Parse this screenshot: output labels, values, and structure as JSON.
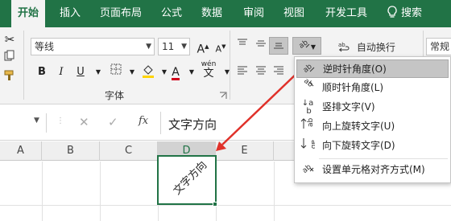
{
  "tabs": [
    "开始",
    "插入",
    "页面布局",
    "公式",
    "数据",
    "审阅",
    "视图",
    "开发工具"
  ],
  "tab_active_index": 0,
  "search_label": "搜索",
  "ribbon": {
    "font_name": "等线",
    "font_size": "11",
    "font_group_label": "字体",
    "wrap_text_label": "自动换行",
    "number_format": "常规",
    "bold": "B",
    "italic": "I",
    "underline": "U",
    "increase_font": "A",
    "decrease_font": "A",
    "font_color_letter": "A",
    "wen_label": "wén",
    "wen_char": "文"
  },
  "formula_bar": {
    "fx": "fx",
    "content": "文字方向"
  },
  "columns": [
    "A",
    "B",
    "C",
    "D",
    "E"
  ],
  "selected_column": "D",
  "cell_text": "文字方向",
  "menu_items": [
    {
      "label": "逆时针角度(O)",
      "icon": "angle-ccw-icon",
      "highlighted": true
    },
    {
      "label": "顺时针角度(L)",
      "icon": "angle-cw-icon",
      "highlighted": false
    },
    {
      "label": "竖排文字(V)",
      "icon": "vertical-text-icon",
      "highlighted": false
    },
    {
      "label": "向上旋转文字(U)",
      "icon": "rotate-up-icon",
      "highlighted": false
    },
    {
      "label": "向下旋转文字(D)",
      "icon": "rotate-down-icon",
      "highlighted": false
    },
    {
      "label": "设置单元格对齐方式(M)",
      "icon": "format-alignment-icon",
      "highlighted": false
    }
  ],
  "colors": {
    "ribbon_green": "#217346",
    "arrow_red": "#e0312a",
    "font_color_bar": "#d0011b",
    "fill_color_bar": "#ffd400"
  }
}
